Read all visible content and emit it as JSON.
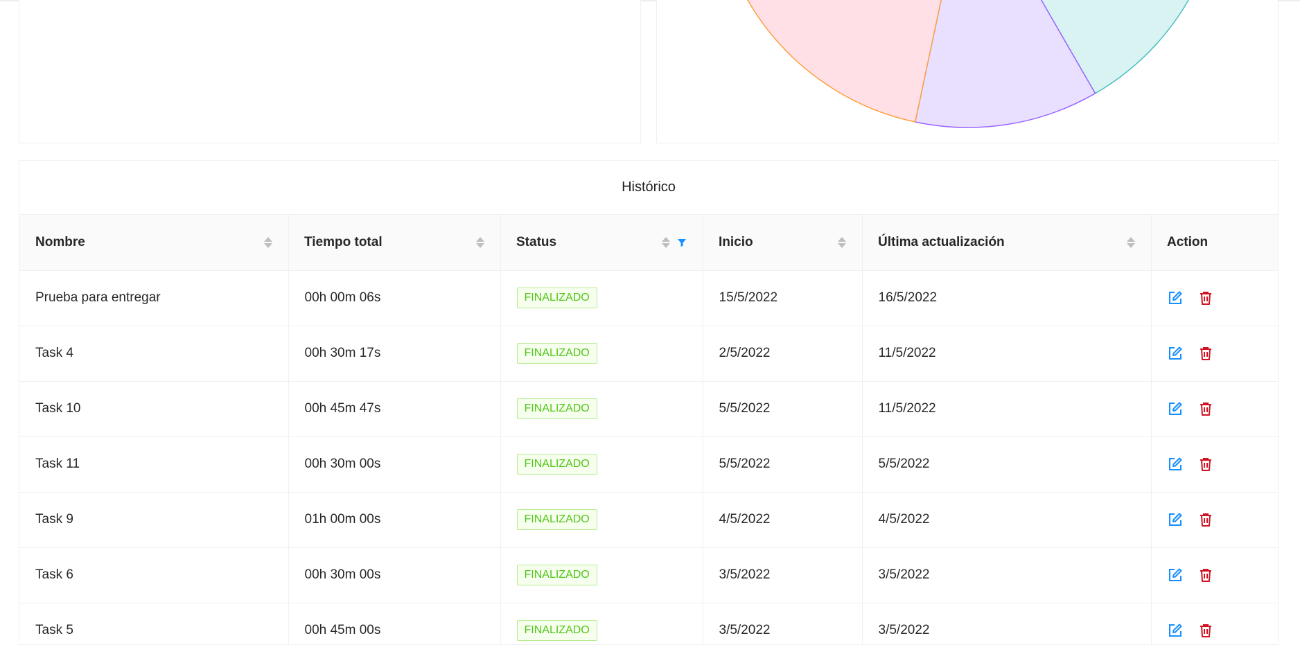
{
  "historico": {
    "title": "Histórico",
    "columns": [
      {
        "label": "Nombre",
        "sortable": true
      },
      {
        "label": "Tiempo total",
        "sortable": true
      },
      {
        "label": "Status",
        "sortable": true,
        "filter_active": true
      },
      {
        "label": "Inicio",
        "sortable": true
      },
      {
        "label": "Última actualización",
        "sortable": true
      },
      {
        "label": "Action",
        "sortable": false
      }
    ],
    "rows": [
      {
        "nombre": "Prueba para entregar",
        "tiempo": "00h 00m 06s",
        "status": "FINALIZADO",
        "inicio": "15/5/2022",
        "ultima": "16/5/2022"
      },
      {
        "nombre": "Task 4",
        "tiempo": "00h 30m 17s",
        "status": "FINALIZADO",
        "inicio": "2/5/2022",
        "ultima": "11/5/2022"
      },
      {
        "nombre": "Task 10",
        "tiempo": "00h 45m 47s",
        "status": "FINALIZADO",
        "inicio": "5/5/2022",
        "ultima": "11/5/2022"
      },
      {
        "nombre": "Task 11",
        "tiempo": "00h 30m 00s",
        "status": "FINALIZADO",
        "inicio": "5/5/2022",
        "ultima": "5/5/2022"
      },
      {
        "nombre": "Task 9",
        "tiempo": "01h 00m 00s",
        "status": "FINALIZADO",
        "inicio": "4/5/2022",
        "ultima": "4/5/2022"
      },
      {
        "nombre": "Task 6",
        "tiempo": "00h 30m 00s",
        "status": "FINALIZADO",
        "inicio": "3/5/2022",
        "ultima": "3/5/2022"
      },
      {
        "nombre": "Task 5",
        "tiempo": "00h 45m 00s",
        "status": "FINALIZADO",
        "inicio": "3/5/2022",
        "ultima": "3/5/2022"
      }
    ]
  },
  "colors": {
    "status_green": "#52c41a",
    "edit_blue": "#1890ff",
    "delete_red": "#cf1322",
    "filter_blue": "#1890ff",
    "pie_slice_pink": "#ffe0e6",
    "pie_slice_purple": "#e9e0ff",
    "pie_slice_teal": "#d9f2f2",
    "pie_edge_orange": "#ff9f40",
    "pie_edge_purple": "#9966ff",
    "pie_edge_teal": "#4bc0c0"
  },
  "icons": {
    "edit": "edit-icon",
    "delete": "delete-icon",
    "filter": "filter-icon",
    "sort": "sort-icon"
  }
}
